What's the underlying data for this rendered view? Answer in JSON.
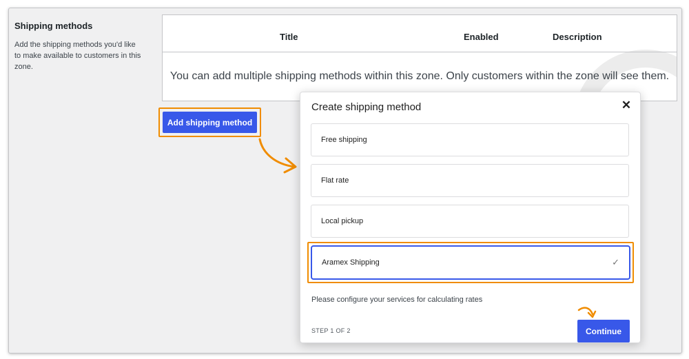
{
  "settings": {
    "section_title": "Shipping methods",
    "section_description": "Add the shipping methods you'd like to make available to customers in this zone."
  },
  "table": {
    "columns": [
      "Title",
      "Enabled",
      "Description"
    ],
    "empty_message": "You can add multiple shipping methods within this zone. Only customers within the zone will see them."
  },
  "add_button_label": "Add shipping method",
  "modal": {
    "title": "Create shipping method",
    "close_glyph": "✕",
    "options": [
      {
        "label": "Free shipping",
        "selected": false
      },
      {
        "label": "Flat rate",
        "selected": false
      },
      {
        "label": "Local pickup",
        "selected": false
      },
      {
        "label": "Aramex Shipping",
        "selected": true
      }
    ],
    "check_glyph": "✓",
    "hint": "Please configure your services for calculating rates",
    "step": "STEP 1 OF 2",
    "continue_label": "Continue"
  },
  "colors": {
    "primary": "#3858e9",
    "highlight": "#f08c00",
    "background": "#f0f0f1",
    "border": "#c3c4c7"
  }
}
